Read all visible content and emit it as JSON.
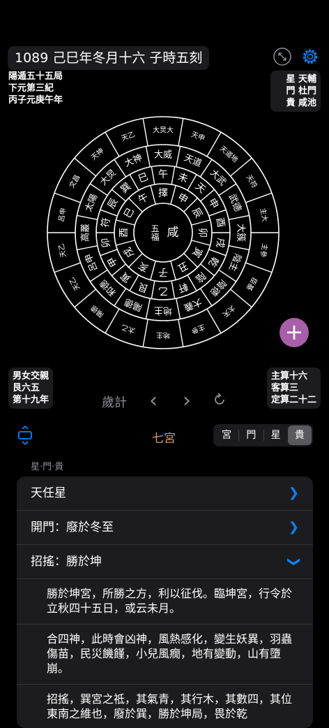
{
  "header": {
    "title": "1089 己巳年冬月十六 子時五刻",
    "left_info": [
      "陽遁五十五局",
      "下元第三紀",
      "丙子元庚午年"
    ],
    "right_info": [
      "星 天輔",
      "門 杜門",
      "貴 咸池"
    ]
  },
  "chart": {
    "center": [
      "五福",
      "咸"
    ],
    "ring1": [
      "擇",
      "申",
      "辰",
      "卯",
      "寅",
      "丑",
      "子",
      "亥",
      "戌",
      "酉",
      "巳",
      "午"
    ],
    "ring2": [
      "午",
      "未",
      "天",
      "申",
      "酉",
      "戌",
      "乾",
      "陰",
      "軒",
      "乙",
      "艮",
      "寅",
      "甲",
      "卯",
      "符",
      "辰",
      "巽",
      "巳"
    ],
    "ring3": [
      "大威",
      "天道",
      "大武",
      "武德",
      "大簇",
      "陰主",
      "陰德",
      "大義",
      "地主",
      "陽德",
      "和德",
      "呂申",
      "高叢",
      "太陽",
      "大炅",
      "大神"
    ],
    "ring4": [
      "大炅大",
      "天申",
      "天道地",
      "天符",
      "主大",
      "主參",
      "臣基",
      "太天",
      "主參",
      "地主",
      "太乙",
      "陽德",
      "天乙",
      "天乙",
      "呂申",
      "文昌",
      "天神",
      "天乙"
    ],
    "highlight": "陰"
  },
  "bottom_left": [
    "男女交親",
    "艮六五",
    "第十九年"
  ],
  "bottom_right": [
    "主算十六",
    "客算三",
    "定算二十二"
  ],
  "fab_label": "+",
  "nav": {
    "label": "歲計",
    "prev": "‹",
    "next": "›"
  },
  "gong_label": "七宮",
  "segments": [
    "宮",
    "門",
    "星",
    "貴"
  ],
  "selected_segment": "貴",
  "section_label": "星·門·貴",
  "list": {
    "row1": "天任星",
    "row2": "開門：廢於冬至",
    "row3": "招搖：勝於坤",
    "para1": "勝於坤宮，所勝之方，利以征伐。臨坤宮，行令於立秋四十五日，或云未月。",
    "para2": "合四神，此時會凶神，風熱感化，變生妖異，羽蟲傷苗，民災饑饉，小兒風癇，地有變動，山有墮崩。",
    "para3": "招搖，巽宮之祗，其氣青，其行木，其數四，其位東南之維也，廢於巽，勝於坤局，畏於乾"
  },
  "colors": {
    "accent": "#0a84ff",
    "fab": "#a85ea8",
    "gong": "#d79a65",
    "highlight": "#b05db5"
  }
}
